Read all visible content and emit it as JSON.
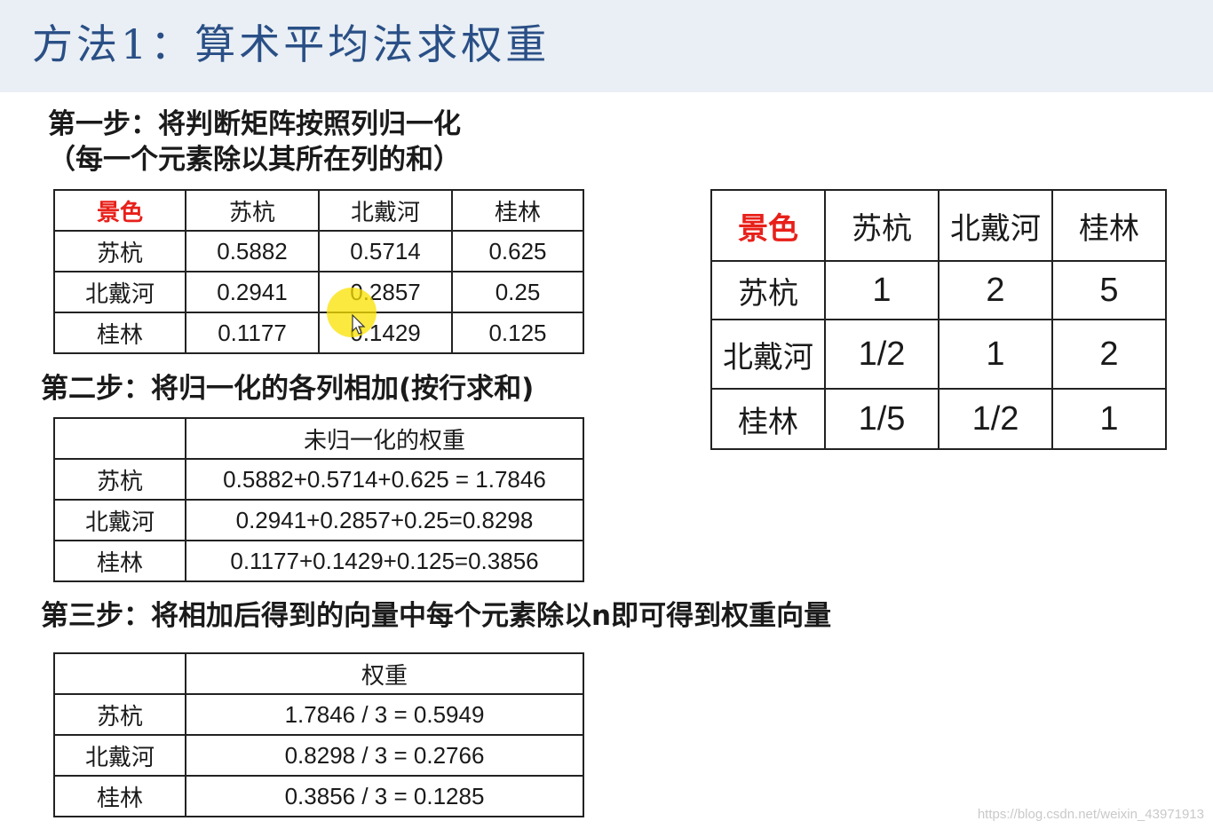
{
  "title": "方法1：算术平均法求权重",
  "step1": {
    "line1": "第一步：将判断矩阵按照列归一化",
    "line2": "（每一个元素除以其所在列的和）"
  },
  "step2": "第二步：将归一化的各列相加(按行求和)",
  "step3": "第三步：将相加后得到的向量中每个元素除以n即可得到权重向量",
  "labels": {
    "scenery": "景色",
    "suhang": "苏杭",
    "beidaihe": "北戴河",
    "guilin": "桂林",
    "unnormalized_weight": "未归一化的权重",
    "weight": "权重"
  },
  "normalized_matrix": [
    [
      "0.5882",
      "0.5714",
      "0.625"
    ],
    [
      "0.2941",
      "0.2857",
      "0.25"
    ],
    [
      "0.1177",
      "0.1429",
      "0.125"
    ]
  ],
  "row_sums": [
    "0.5882+0.5714+0.625 = 1.7846",
    "0.2941+0.2857+0.25=0.8298",
    "0.1177+0.1429+0.125=0.3856"
  ],
  "weights": [
    "1.7846 / 3 = 0.5949",
    "0.8298 / 3 = 0.2766",
    "0.3856 / 3 = 0.1285"
  ],
  "judgment_matrix": [
    [
      "1",
      "2",
      "5"
    ],
    [
      "1/2",
      "1",
      "2"
    ],
    [
      "1/5",
      "1/2",
      "1"
    ]
  ],
  "watermark": "https://blog.csdn.net/weixin_43971913",
  "colors": {
    "title": "#2a4f86",
    "header_bg": "#e9eff4",
    "highlight_red": "#e8201a"
  }
}
